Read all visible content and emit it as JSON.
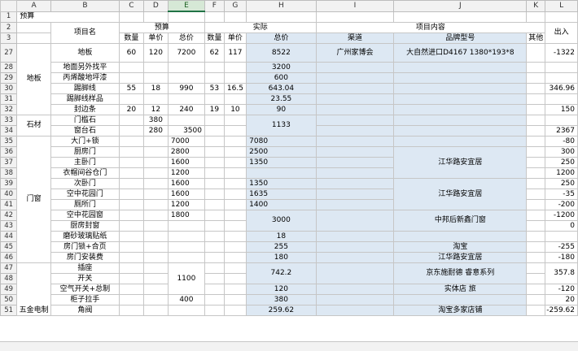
{
  "columns": [
    "A",
    "B",
    "C",
    "D",
    "E",
    "F",
    "G",
    "H",
    "I",
    "J",
    "K",
    "L"
  ],
  "selected_column": "E",
  "rows": [
    "1",
    "2",
    "3",
    "27",
    "28",
    "29",
    "30",
    "31",
    "32",
    "33",
    "34",
    "35",
    "36",
    "37",
    "38",
    "39",
    "40",
    "41",
    "42",
    "43",
    "44",
    "45",
    "46",
    "47",
    "48",
    "49",
    "50",
    "51"
  ],
  "title": "预算",
  "headers": {
    "item_name": "项目名",
    "budget": "预算",
    "actual": "实际",
    "project_content": "项目内容",
    "out": "出入",
    "qty": "数量",
    "unit_price": "单价",
    "total": "总价",
    "channel": "渠道",
    "brand_model": "品牌型号",
    "other": "其他"
  },
  "groups": {
    "floor": "地板",
    "stone": "石材",
    "doors": "门窗",
    "hardware": "五金电制"
  },
  "items": {
    "floor": "地板",
    "floor_level": "地面另外找平",
    "paint": "丙烯酸地坪漆",
    "skirting": "踢脚线",
    "skirting_sample": "踢脚线样品",
    "edge": "封边条",
    "threshold": "门槛石",
    "sill": "窗台石",
    "entry_lock": "大门+锁",
    "kitchen_door": "厨房门",
    "master_door": "主卧门",
    "closet_door": "衣帽间谷仓门",
    "second_door": "次卧门",
    "garden_west_door": "空中花园门",
    "bath_door": "厕所门",
    "garden_window": "空中花园窗",
    "kitchen_window": "厨房封窗",
    "frosted_film": "磨砂玻璃贴纸",
    "lock_hinge": "房门锁+合页",
    "door_install": "房门安装费",
    "socket": "插座",
    "switch": "开关",
    "breaker": "空气开关+总制",
    "cabinet_handle": "柜子拉手",
    "angle_valve": "角阀"
  },
  "values": {
    "r27": {
      "c": "60",
      "d": "120",
      "e": "7200",
      "f": "62",
      "g": "117",
      "h": "8522",
      "i": "广州家博会",
      "j": "大自然进口D4167 1380*193*8",
      "l": "-1322"
    },
    "r28": {
      "h": "3200"
    },
    "r29": {
      "h": "600"
    },
    "r30": {
      "c": "55",
      "d": "18",
      "e": "990",
      "f": "53",
      "g": "16.5",
      "h": "643.04",
      "l": "346.96"
    },
    "r31": {
      "h": "23.55"
    },
    "r32": {
      "c": "20",
      "d": "12",
      "e": "240",
      "f": "19",
      "g": "10",
      "h": "90",
      "l": "150"
    },
    "r33": {
      "d": "380"
    },
    "r34": {
      "d": "280",
      "e": "3500",
      "h": "1133",
      "l": "2367"
    },
    "r35": {
      "e": "7000",
      "h": "7080",
      "l": "-80"
    },
    "r36": {
      "e": "2800",
      "h": "2500",
      "l": "300"
    },
    "r37": {
      "e": "1600",
      "h": "1350",
      "l": "250"
    },
    "r38": {
      "e": "1200",
      "l": "1200"
    },
    "r39": {
      "e": "1600",
      "h": "1350",
      "l": "250"
    },
    "r40": {
      "e": "1600",
      "h": "1635",
      "l": "-35"
    },
    "r41": {
      "e": "1200",
      "h": "1400",
      "l": "-200"
    },
    "r42": {
      "e": "1800",
      "h": "3000",
      "l": "-1200"
    },
    "r43": {
      "l": "0"
    },
    "r44": {
      "h": "18"
    },
    "r45": {
      "h": "255",
      "l": "-255"
    },
    "r46": {
      "h": "180",
      "l": "-180"
    },
    "r47": {
      "h": "742.2",
      "e": "1100",
      "l": "357.8"
    },
    "r49": {
      "h": "120",
      "l": "-120"
    },
    "r50": {
      "e": "400",
      "h": "380",
      "l": "20"
    },
    "r51": {
      "h": "259.62",
      "l": "-259.62"
    }
  },
  "channels": {
    "jianghua": "江华路安宜居",
    "jianghua2": "江华路安宜居",
    "zhongbang": "中邦后新鑫门窗",
    "taobao": "淘宝",
    "jianghua3": "江华路安宜居",
    "jd": "京东施耐德 睿意系列",
    "store": "实体店 旅",
    "taobao_multi": "淘宝多家店铺"
  }
}
